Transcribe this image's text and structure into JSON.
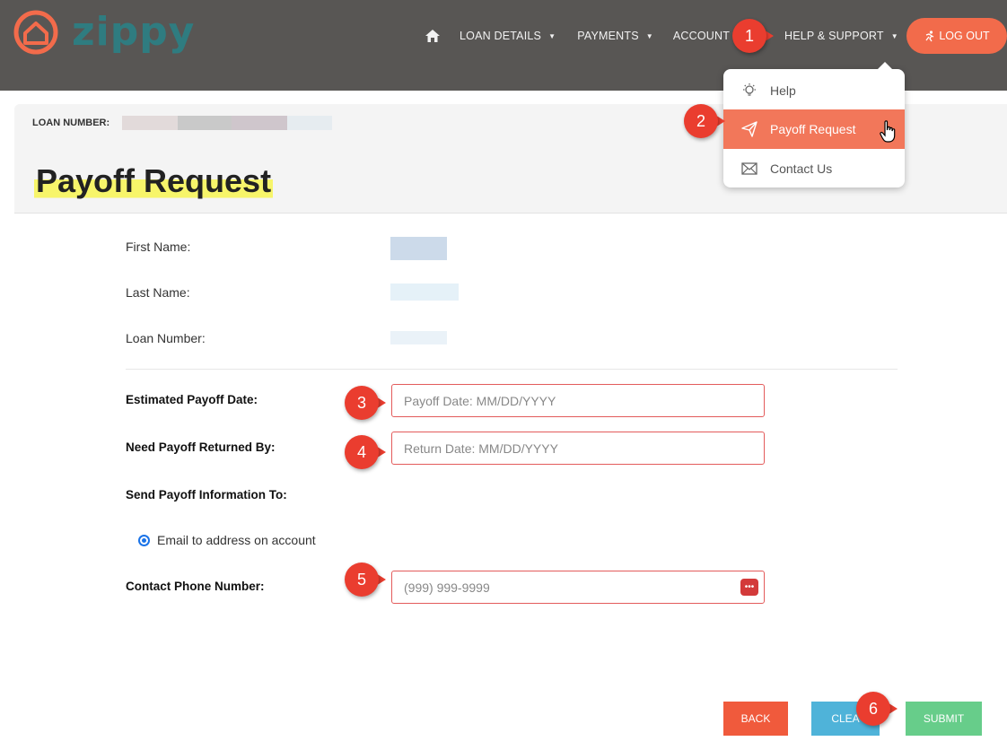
{
  "brand": {
    "name": "zippy",
    "logo_color": "#f26b4b",
    "text_color": "#2f7c80"
  },
  "nav": {
    "home_icon": "home-icon",
    "items": [
      {
        "label": "LOAN DETAILS"
      },
      {
        "label": "PAYMENTS"
      },
      {
        "label": "ACCOUNT II"
      },
      {
        "label": "HELP & SUPPORT"
      }
    ],
    "logout_label": "LOG OUT"
  },
  "dropdown": {
    "items": [
      {
        "label": "Help",
        "icon": "lightbulb-icon"
      },
      {
        "label": "Payoff Request",
        "icon": "paper-plane-icon",
        "active": true
      },
      {
        "label": "Contact Us",
        "icon": "envelope-icon"
      }
    ]
  },
  "page": {
    "loan_number_label": "LOAN NUMBER:",
    "title": "Payoff Request"
  },
  "form": {
    "first_name_label": "First Name:",
    "last_name_label": "Last Name:",
    "loan_number_label": "Loan Number:",
    "payoff_date_label": "Estimated Payoff Date:",
    "payoff_date_placeholder": "Payoff Date: MM/DD/YYYY",
    "return_date_label": "Need Payoff Returned By:",
    "return_date_placeholder": "Return Date: MM/DD/YYYY",
    "send_to_label": "Send Payoff Information To:",
    "email_option": "Email to address on account",
    "phone_label": "Contact Phone Number:",
    "phone_placeholder": "(999) 999-9999"
  },
  "buttons": {
    "back": "BACK",
    "clear": "CLEA",
    "submit": "SUBMIT"
  },
  "callouts": [
    "1",
    "2",
    "3",
    "4",
    "5",
    "6"
  ],
  "colors": {
    "header_bg": "#585654",
    "accent": "#f26b4b",
    "active_item": "#f2775a",
    "callout": "#ea3d2f",
    "input_border": "#e35b5b",
    "back_button": "#f05a3c",
    "clear_button": "#4fb3d9",
    "submit_button": "#67cd8a",
    "title_highlight": "#f7f56a"
  }
}
